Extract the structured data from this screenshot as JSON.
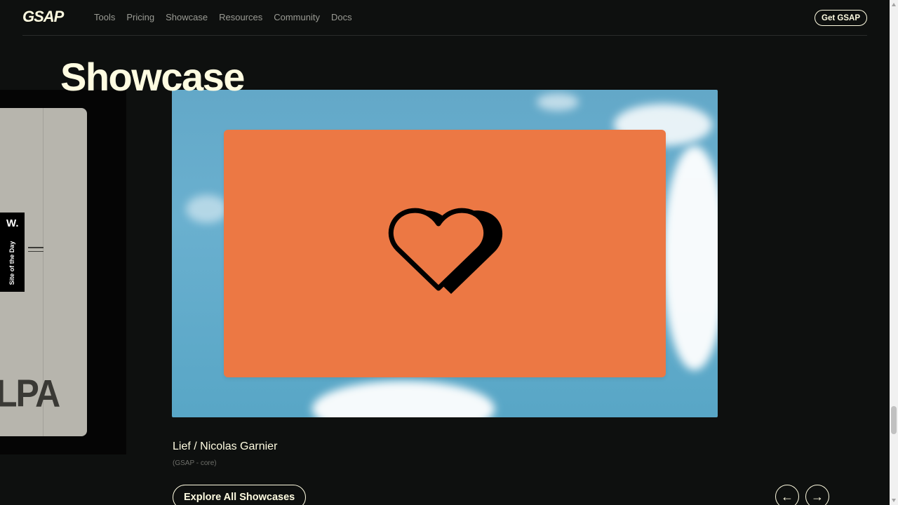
{
  "header": {
    "logo": "GSAP",
    "nav": [
      "Tools",
      "Pricing",
      "Showcase",
      "Resources",
      "Community",
      "Docs"
    ],
    "cta": "Get GSAP"
  },
  "page_title": "Showcase",
  "previous_card": {
    "brand_text": "LPA",
    "award_mark": "W.",
    "award_label": "Site of the Day"
  },
  "featured": {
    "title": "Lief / Nicolas Garnier",
    "subtitle": "(GSAP - core)",
    "accent": "#ec7844",
    "icon": "heart-icon"
  },
  "actions": {
    "explore": "Explore All Showcases",
    "prev": "←",
    "next": "→"
  },
  "colors": {
    "background": "#0e100f",
    "text": "#fffce1",
    "muted": "#9a9b94"
  }
}
